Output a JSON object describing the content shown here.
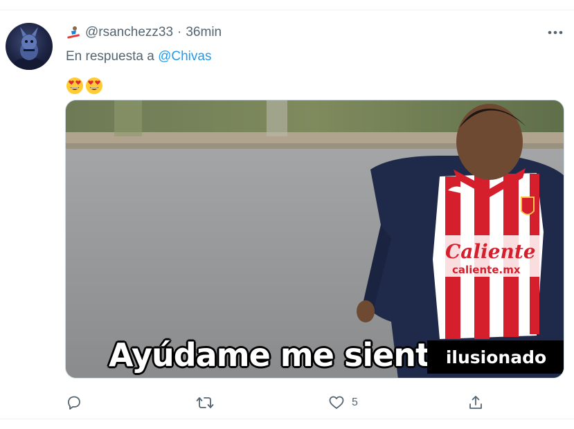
{
  "tweet": {
    "handle": "@rsanchezz33",
    "separator": "·",
    "time": "36min",
    "reply_prefix": "En respuesta a ",
    "reply_to": "@Chivas",
    "emojis": [
      "smiling-face-with-heart-eyes-icon",
      "smiling-face-with-heart-eyes-icon"
    ],
    "media": {
      "caption_main": "Ayúdame me siento",
      "caption_tag": "ilusionado",
      "jersey_sponsor": "Caliente",
      "jersey_sponsor_url": "caliente.mx"
    },
    "actions": {
      "reply_count": "",
      "retweet_count": "",
      "like_count": "5",
      "share_count": ""
    }
  },
  "colors": {
    "link": "#1d9bf0",
    "secondary_text": "#536471",
    "jersey_red": "#d61f2c"
  }
}
